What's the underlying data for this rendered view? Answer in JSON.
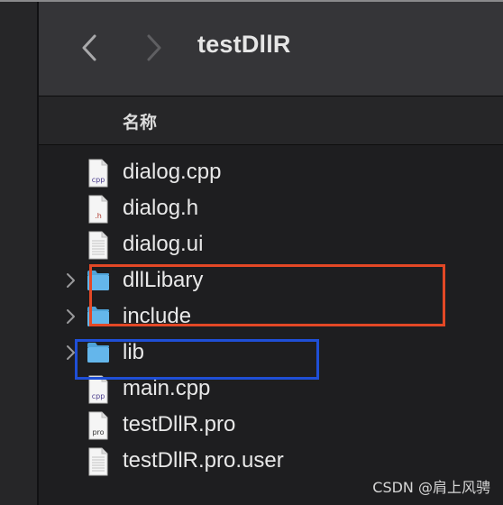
{
  "toolbar": {
    "title": "testDllR",
    "back_icon": "chevron-left-icon",
    "forward_icon": "chevron-right-icon"
  },
  "list_header": {
    "name_column": "名称"
  },
  "files": [
    {
      "name": "dialog.cpp",
      "kind": "file",
      "badge": "cpp",
      "badge_color": "#4a3c8c",
      "expandable": false
    },
    {
      "name": "dialog.h",
      "kind": "file",
      "badge": ".h",
      "badge_color": "#b03a2e",
      "expandable": false
    },
    {
      "name": "dialog.ui",
      "kind": "file",
      "badge": "",
      "badge_color": "#888888",
      "expandable": false
    },
    {
      "name": "dllLibary",
      "kind": "folder",
      "badge": "",
      "expandable": true
    },
    {
      "name": "include",
      "kind": "folder",
      "badge": "",
      "expandable": true
    },
    {
      "name": "lib",
      "kind": "folder",
      "badge": "",
      "expandable": true
    },
    {
      "name": "main.cpp",
      "kind": "file",
      "badge": "cpp",
      "badge_color": "#4a3c8c",
      "expandable": false
    },
    {
      "name": "testDllR.pro",
      "kind": "file",
      "badge": "pro",
      "badge_color": "#333333",
      "expandable": false
    },
    {
      "name": "testDllR.pro.user",
      "kind": "file",
      "badge": "",
      "badge_color": "#888888",
      "expandable": false
    }
  ],
  "annotations": {
    "red_box_color": "#e34826",
    "blue_box_color": "#1f4fd6"
  },
  "watermark": "CSDN @肩上风骋"
}
